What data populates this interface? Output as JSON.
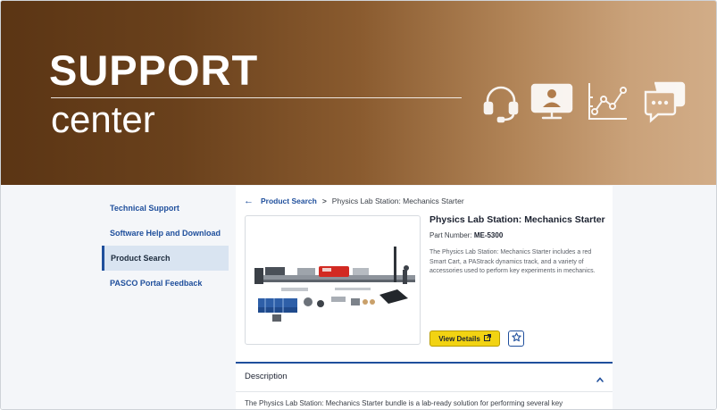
{
  "banner": {
    "title": "SUPPORT",
    "subtitle": "center",
    "icons": [
      "headset-icon",
      "monitor-user-icon",
      "line-chart-icon",
      "chat-bubble-icon"
    ]
  },
  "sidebar": {
    "items": [
      {
        "label": "Technical Support",
        "active": false
      },
      {
        "label": "Software Help and Download",
        "active": false
      },
      {
        "label": "Product Search",
        "active": true
      },
      {
        "label": "PASCO Portal Feedback",
        "active": false
      }
    ]
  },
  "breadcrumb": {
    "back_icon": "arrow-left-icon",
    "link": "Product Search",
    "separator": ">",
    "current": "Physics Lab Station: Mechanics Starter"
  },
  "product": {
    "title": "Physics Lab Station: Mechanics Starter",
    "part_label": "Part Number:",
    "part_number": "ME-5300",
    "description": "The Physics Lab Station: Mechanics Starter includes a red Smart Cart, a PAStrack dynamics track, and a variety of accessories used to perform key experiments in mechanics.",
    "view_details_label": "View Details",
    "view_details_icon": "external-link-icon",
    "favorite_icon": "star-icon"
  },
  "description_section": {
    "heading": "Description",
    "chevron_icon": "chevron-up-icon",
    "body": "The Physics Lab Station: Mechanics Starter bundle is a lab-ready solution for performing several key"
  },
  "colors": {
    "link_blue": "#1f4f9c",
    "button_yellow": "#f2d312",
    "banner_dark": "#5b3514",
    "banner_light": "#d2ad88",
    "active_bg": "#d9e4f1"
  }
}
